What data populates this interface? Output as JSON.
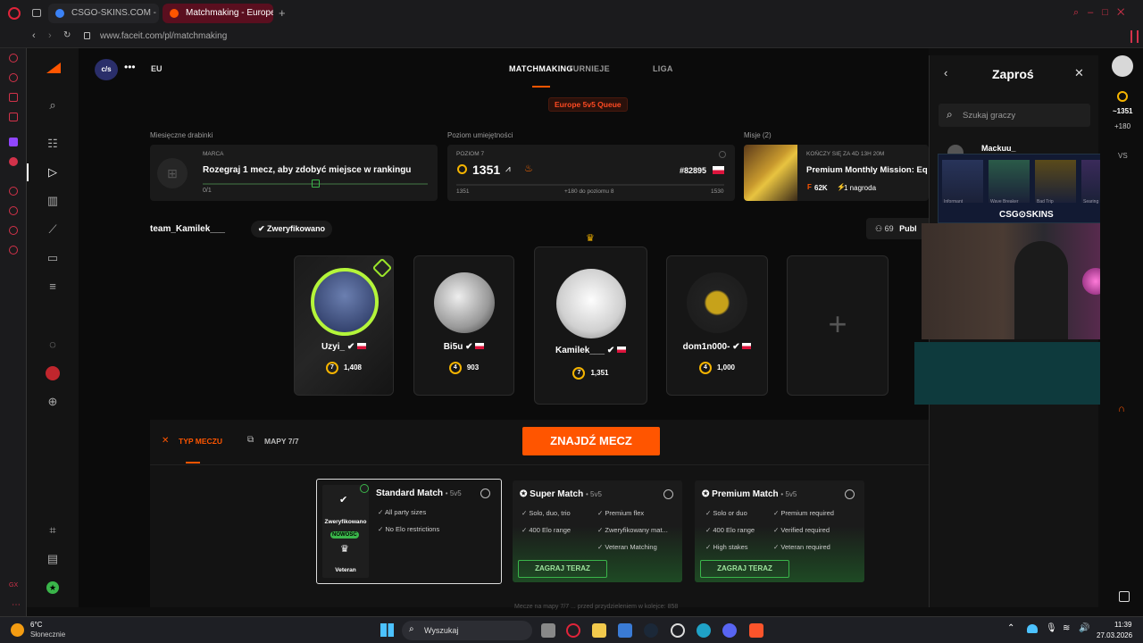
{
  "browser": {
    "tabs": [
      {
        "label": "CSGO-SKINS.COM - Najle"
      },
      {
        "label": "Matchmaking - Europe 5v"
      }
    ],
    "url": "www.faceit.com/pl/matchmaking"
  },
  "header": {
    "org_logo_text": "c/s",
    "region": "EU",
    "nav": [
      "MATCHMAKING",
      "TURNIEJE",
      "LIGA"
    ],
    "queue_badge": "Europe 5v5 Queue"
  },
  "stats": {
    "ladder": {
      "section": "Miesięczne drabinki",
      "month": "MARCA",
      "text": "Rozegraj 1 mecz, aby zdobyć miejsce w rankingu",
      "progress": "0/1",
      "progress_fraction": 0
    },
    "skill": {
      "section": "Poziom umiejętności",
      "level_label": "POZIOM 7",
      "elo": "1351",
      "rank": "#82895",
      "min": "1351",
      "to_next": "+180 do poziomu 8",
      "max": "1530"
    },
    "missions": {
      "section": "Misje (2)",
      "ends": "KOŃCZY SIĘ ZA 4D 13H 20M",
      "title": "Premium Monthly Mission: Eq",
      "reward1": "62K",
      "reward2": "1 nagroda"
    }
  },
  "team": {
    "name": "team_Kamilek___",
    "verified_label": "Zweryfikowano",
    "public_count": "69",
    "public_label": "Publ",
    "players": [
      {
        "name": "Uzyi_",
        "level": "7",
        "elo": "1,408"
      },
      {
        "name": "Bi5u",
        "level": "4",
        "elo": "903"
      },
      {
        "name": "Kamilek___",
        "level": "7",
        "elo": "1,351"
      },
      {
        "name": "dom1n000-",
        "level": "4",
        "elo": "1,000"
      }
    ],
    "empty_slot": "+"
  },
  "match": {
    "tab_type": "TYP MECZU",
    "tab_maps": "MAPY 7/7",
    "find_button": "ZNAJDŹ MECZ",
    "footer_text": "Mecze na mapy 7/7 ... przed przydzieleniem w kolejce: 858",
    "modes": [
      {
        "title": "Standard Match",
        "suffix": "• 5v5",
        "features": [
          "All party sizes",
          "No Elo restrictions"
        ],
        "badge_verified": "Zweryfikowano",
        "badge_new": "NOWOŚĆ",
        "badge_veteran": "Veteran"
      },
      {
        "title": "Super Match",
        "suffix": "• 5v5",
        "features": [
          "Solo, duo, trio",
          "Premium flex",
          "400 Elo range",
          "Zweryfikowany mat...",
          "Veteran Matching"
        ],
        "button": "ZAGRAJ TERAZ"
      },
      {
        "title": "Premium Match",
        "suffix": "• 5v5",
        "features": [
          "Solo or duo",
          "Premium required",
          "400 Elo range",
          "Verified required",
          "High stakes",
          "Veteran required"
        ],
        "button": "ZAGRAJ TERAZ"
      }
    ]
  },
  "invite": {
    "title": "Zaproś",
    "search_placeholder": "Szukaj graczy",
    "friends": [
      "Mackuu_"
    ]
  },
  "overlay": {
    "brand": "CSG⊙SKINS",
    "skins": [
      "Informant",
      "Wave Breaker",
      "Bad Trip",
      "Searing Rage"
    ]
  },
  "right_strip": {
    "elo": "~1351",
    "gain": "+180",
    "vs": "VS"
  },
  "taskbar": {
    "temp": "6°C",
    "weather": "Słonecznie",
    "search": "Wyszukaj",
    "time": "11:39",
    "date": "27.03.2026"
  },
  "colors": {
    "accent": "#ff5500",
    "success": "#3ab54a",
    "level_gold": "#f5b400"
  }
}
